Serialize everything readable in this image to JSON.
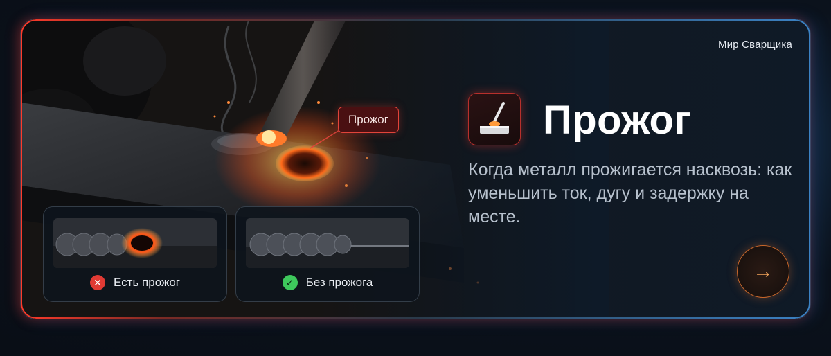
{
  "brand": "Мир Сварщика",
  "tag_label": "Прожог",
  "title": "Прожог",
  "description": "Когда металл прожигается насквозь: как уменьшить ток, дугу и задержку на месте.",
  "comparisons": [
    {
      "label": "Есть прожог",
      "status_icon": "cross-icon",
      "status_symbol": "✕"
    },
    {
      "label": "Без прожога",
      "status_icon": "check-icon",
      "status_symbol": "✓"
    }
  ],
  "cta_symbol": "→",
  "colors": {
    "accent_red": "#e2443a",
    "accent_orange": "#f0a25a",
    "bad": "#e03a34",
    "good": "#3ec85c"
  }
}
